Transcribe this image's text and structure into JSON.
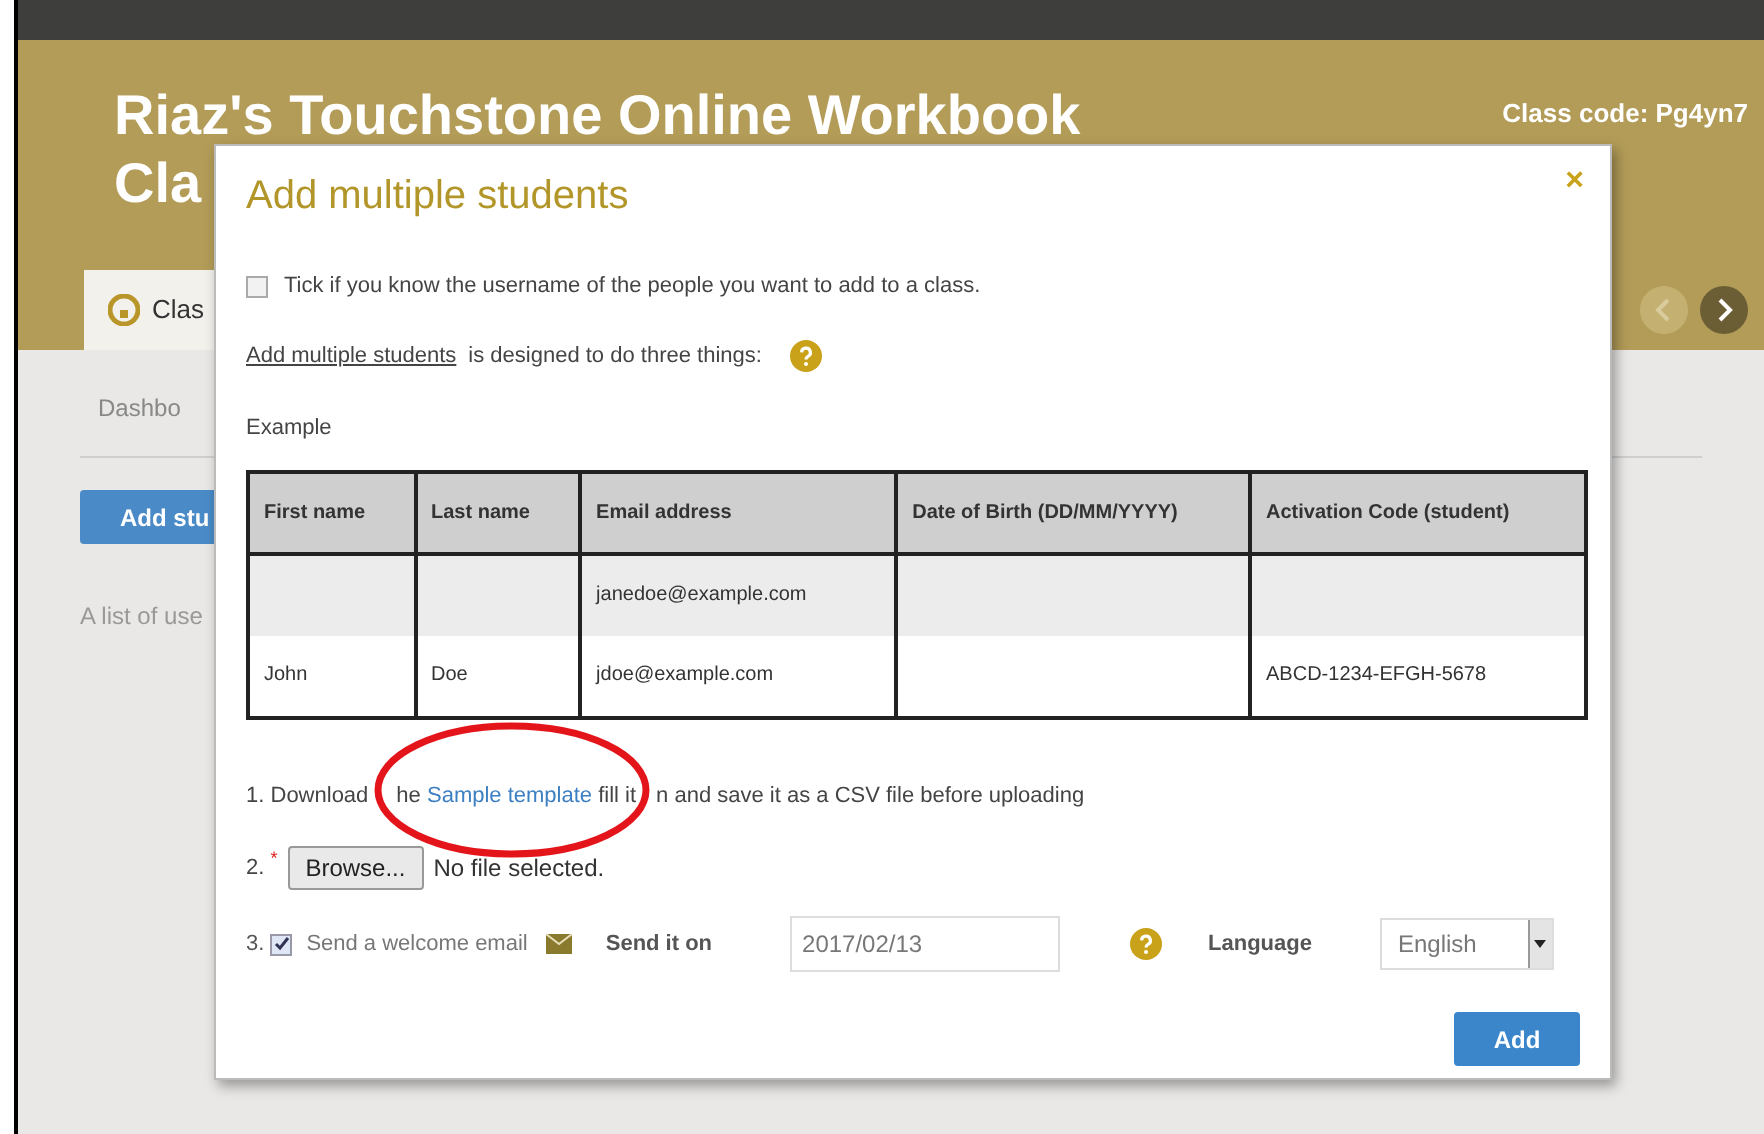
{
  "header": {
    "title": "Riaz's Touchstone Online Workbook",
    "title_line2": "Cla",
    "class_code": "Class code: Pg4yn7"
  },
  "tab": {
    "label": "Clas"
  },
  "subnav": {
    "label": "Dashbo"
  },
  "add_button": "Add stu",
  "list_text": "A list of use",
  "modal": {
    "title": "Add multiple students",
    "close": "×",
    "username_option": {
      "label": "Tick if you know the username of the people you want to add to a class.",
      "checked": false
    },
    "intro": {
      "link": "Add multiple students",
      "text": "is designed to do three things:"
    },
    "example_label": "Example",
    "table": {
      "columns": [
        "First name",
        "Last name",
        "Email address",
        "Date of Birth (DD/MM/YYYY)",
        "Activation Code (student)"
      ],
      "rows": [
        [
          "",
          "",
          "janedoe@example.com",
          "",
          ""
        ],
        [
          "John",
          "Doe",
          "jdoe@example.com",
          "",
          "ABCD-1234-EFGH-5678"
        ]
      ]
    },
    "step1": {
      "number": "1.",
      "before": "Download",
      "partial": "he",
      "link": "Sample template",
      "middle": "fill it",
      "after": "n and save it as a CSV file before uploading"
    },
    "step2": {
      "number": "2.",
      "required": "*",
      "browse_button": "Browse...",
      "file_status": "No file selected."
    },
    "step3": {
      "number": "3.",
      "send_email": {
        "label": "Send a welcome email",
        "checked": true
      },
      "send_on_label": "Send it on",
      "date": "2017/02/13",
      "language_label": "Language",
      "language": "English"
    },
    "submit": "Add"
  }
}
